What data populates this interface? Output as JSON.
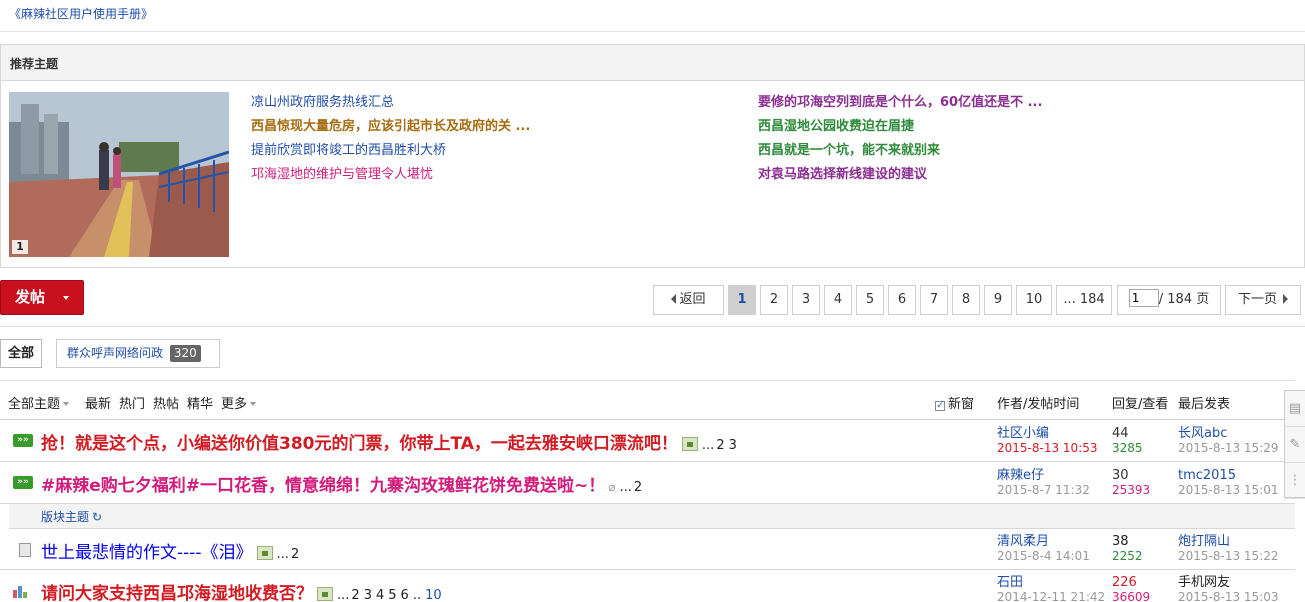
{
  "manual_link": "《麻辣社区用户使用手册》",
  "recommend": {
    "title": "推荐主题",
    "photo_index": "1",
    "col1": [
      {
        "text": "凉山州政府服务热线汇总",
        "color": "#1f4ea8",
        "bold": false
      },
      {
        "text": "西昌惊现大量危房，应该引起市长及政府的关 ...",
        "color": "#a56c12",
        "bold": true
      },
      {
        "text": "提前欣赏即将竣工的西昌胜利大桥",
        "color": "#1f4ea8",
        "bold": false
      },
      {
        "text": "邛海湿地的维护与管理令人堪忧",
        "color": "#d21c7c",
        "bold": false
      }
    ],
    "col2": [
      {
        "text": "要修的邛海空列到底是个什么，60亿值还是不 ...",
        "color": "#8a2e91",
        "bold": true
      },
      {
        "text": "西昌湿地公园收费迫在眉捷",
        "color": "#2e8b3a",
        "bold": true
      },
      {
        "text": "西昌就是一个坑，能不来就别来",
        "color": "#2e8b3a",
        "bold": true
      },
      {
        "text": "对袁马路选择新线建设的建议",
        "color": "#8a2e91",
        "bold": true
      }
    ]
  },
  "post_button": "发帖",
  "pager": {
    "back": "返回",
    "pages": [
      "1",
      "2",
      "3",
      "4",
      "5",
      "6",
      "7",
      "8",
      "9",
      "10",
      "... 184"
    ],
    "current": "1",
    "input_value": "1",
    "total": "/ 184 页",
    "next": "下一页"
  },
  "type_tabs": {
    "all": "全部",
    "category": "群众呼声网络问政",
    "category_count": "320"
  },
  "list_header": {
    "all_topics": "全部主题",
    "latest": "最新",
    "hot": "热门",
    "hot_posts": "热帖",
    "digest": "精华",
    "more": "更多",
    "new_window": "新窗",
    "author_col": "作者/发帖时间",
    "reply_col": "回复/查看",
    "last_col": "最后发表"
  },
  "sticky_rows": [
    {
      "title": "抢！就是这个点，小编送你价值380元的门票，你带上TA，一起去雅安峡口漂流吧！",
      "title_color": "#d21c23",
      "pages_prefix": "...",
      "pages": [
        "2",
        "3"
      ],
      "author": "社区小编",
      "date": "2015-8-13 10:53",
      "date_color": "#d21c23",
      "replies": "44",
      "views": "3285",
      "views_color": "#2e8b3a",
      "last_user": "长风abc",
      "last_date": "2015-8-13 15:29"
    },
    {
      "title": "#麻辣e购七夕福利#一口花香，情意绵绵！九寨沟玫瑰鲜花饼免费送啦~！",
      "title_color": "#d21c7c",
      "pages_prefix": "...",
      "pages": [
        "2"
      ],
      "author": "麻辣e仔",
      "date": "2015-8-7 11:32",
      "date_color": "#999999",
      "replies": "30",
      "views": "25393",
      "views_color": "#d21c7c",
      "last_user": "tmc2015",
      "last_date": "2015-8-13 15:01"
    }
  ],
  "section_label": "版块主题",
  "rows": [
    {
      "title": "世上最悲情的作文----《泪》",
      "pages_prefix": "...",
      "pages": [
        "2"
      ],
      "author": "清风柔月",
      "date": "2015-8-4 14:01",
      "replies": "38",
      "replies_color": "#222222",
      "views": "2252",
      "views_color": "#2e8b3a",
      "last_user": "炮打隔山",
      "last_date": "2015-8-13 15:22"
    },
    {
      "title": "请问大家支持西昌邛海湿地收费否？",
      "title_color": "#d21c23",
      "pages_prefix": "...",
      "pages": [
        "2",
        "3",
        "4",
        "5",
        "6",
        "..",
        "10"
      ],
      "author": "石田",
      "date": "2014-12-11 21:42",
      "replies": "226",
      "replies_color": "#d21c23",
      "views": "36609",
      "views_color": "#d21c7c",
      "last_user": "手机网友",
      "last_date": "2015-8-13 15:03"
    }
  ],
  "side_tool": [
    "▤",
    "✎",
    "⋮"
  ]
}
